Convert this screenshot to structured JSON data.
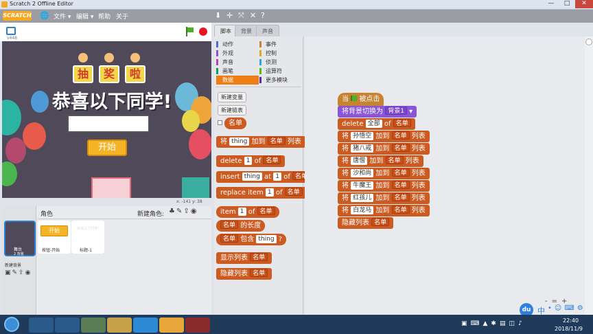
{
  "window": {
    "title": "Scratch 2 Offline Editor",
    "min": "—",
    "max": "□",
    "close": "✕"
  },
  "menu": {
    "logo": "SCRATCH",
    "file": "文件 ▾",
    "edit": "编辑 ▾",
    "help": "帮助",
    "about": "关于"
  },
  "toolbar": {
    "icons": [
      "stamp-icon",
      "grow-icon",
      "shrink-icon",
      "fullscreen-icon",
      "help-icon"
    ]
  },
  "stage_controls": {
    "version": "v448"
  },
  "stage": {
    "title_chars": [
      "抽",
      "奖",
      "啦"
    ],
    "headline": "恭喜以下同学!",
    "input_value": "",
    "start_button": "开始",
    "coords": "x: -141  y: 38"
  },
  "tabs": {
    "scripts": "脚本",
    "backdrops": "背景",
    "sounds": "声音"
  },
  "categories": {
    "left": [
      {
        "label": "动作",
        "color": "#4a6cd4"
      },
      {
        "label": "外观",
        "color": "#8a55d7"
      },
      {
        "label": "声音",
        "color": "#bb42c3"
      },
      {
        "label": "画笔",
        "color": "#0e9a6c"
      },
      {
        "label": "数据",
        "color": "#ee7d16"
      }
    ],
    "right": [
      {
        "label": "事件",
        "color": "#c88330"
      },
      {
        "label": "控制",
        "color": "#e1a91a"
      },
      {
        "label": "侦测",
        "color": "#2ca5e2"
      },
      {
        "label": "运算符",
        "color": "#5cb712"
      },
      {
        "label": "更多模块",
        "color": "#632d99"
      }
    ]
  },
  "palette": {
    "make_var": "新建变量",
    "make_list": "新建链表",
    "list_name": "名单",
    "b_add": {
      "a": "将",
      "thing": "thing",
      "b": "加到",
      "list": "名单",
      "c": "列表"
    },
    "b_delete": {
      "a": "delete",
      "num": "1",
      "b": "of",
      "list": "名单"
    },
    "b_insert": {
      "a": "insert",
      "thing": "thing",
      "b": "at",
      "num": "1",
      "c": "of",
      "list": "名单"
    },
    "b_replace": {
      "a": "replace item",
      "num": "1",
      "b": "of",
      "list": "名单"
    },
    "b_item": {
      "a": "item",
      "num": "1",
      "b": "of",
      "list": "名单"
    },
    "b_length": {
      "list": "名单",
      "a": "的长度"
    },
    "b_contains": {
      "list": "名单",
      "a": "包含",
      "thing": "thing",
      "q": "?"
    },
    "b_show": {
      "a": "显示列表",
      "list": "名单"
    },
    "b_hide": {
      "a": "隐藏列表",
      "list": "名单"
    }
  },
  "script": {
    "hat": {
      "a": "当",
      "b": "被点击"
    },
    "switch": {
      "a": "将背景切换为",
      "val": "背景1"
    },
    "delete_all": {
      "a": "delete",
      "val": "全部",
      "b": "of",
      "list": "名单"
    },
    "adds": [
      {
        "a": "将",
        "name": "孙悟空",
        "b": "加到",
        "list": "名单",
        "c": "列表"
      },
      {
        "a": "将",
        "name": "猪八戒",
        "b": "加到",
        "list": "名单",
        "c": "列表"
      },
      {
        "a": "将",
        "name": "唐僧",
        "b": "加到",
        "list": "名单",
        "c": "列表"
      },
      {
        "a": "将",
        "name": "沙和尚",
        "b": "加到",
        "list": "名单",
        "c": "列表"
      },
      {
        "a": "将",
        "name": "牛魔王",
        "b": "加到",
        "list": "名单",
        "c": "列表"
      },
      {
        "a": "将",
        "name": "红孩儿",
        "b": "加到",
        "list": "名单",
        "c": "列表"
      },
      {
        "a": "将",
        "name": "白龙马",
        "b": "加到",
        "list": "名单",
        "c": "列表"
      }
    ],
    "hide": {
      "a": "隐藏列表",
      "list": "名单"
    }
  },
  "sprites": {
    "header": "角色",
    "new_sprite": "新建角色:",
    "stage_label": "舞台",
    "stage_sub": "2 背景",
    "new_backdrop": "新建背景",
    "items": [
      {
        "label": "按钮-开始",
        "thumb": "开始"
      },
      {
        "label": "标题-1",
        "thumb": "恭喜以下同学!"
      }
    ]
  },
  "zoom": {
    "minus": "-",
    "eq": "=",
    "plus": "+"
  },
  "ime": {
    "logo": "du",
    "lang": "中"
  },
  "tray": {
    "time": "22:40",
    "date": "2018/11/9"
  }
}
